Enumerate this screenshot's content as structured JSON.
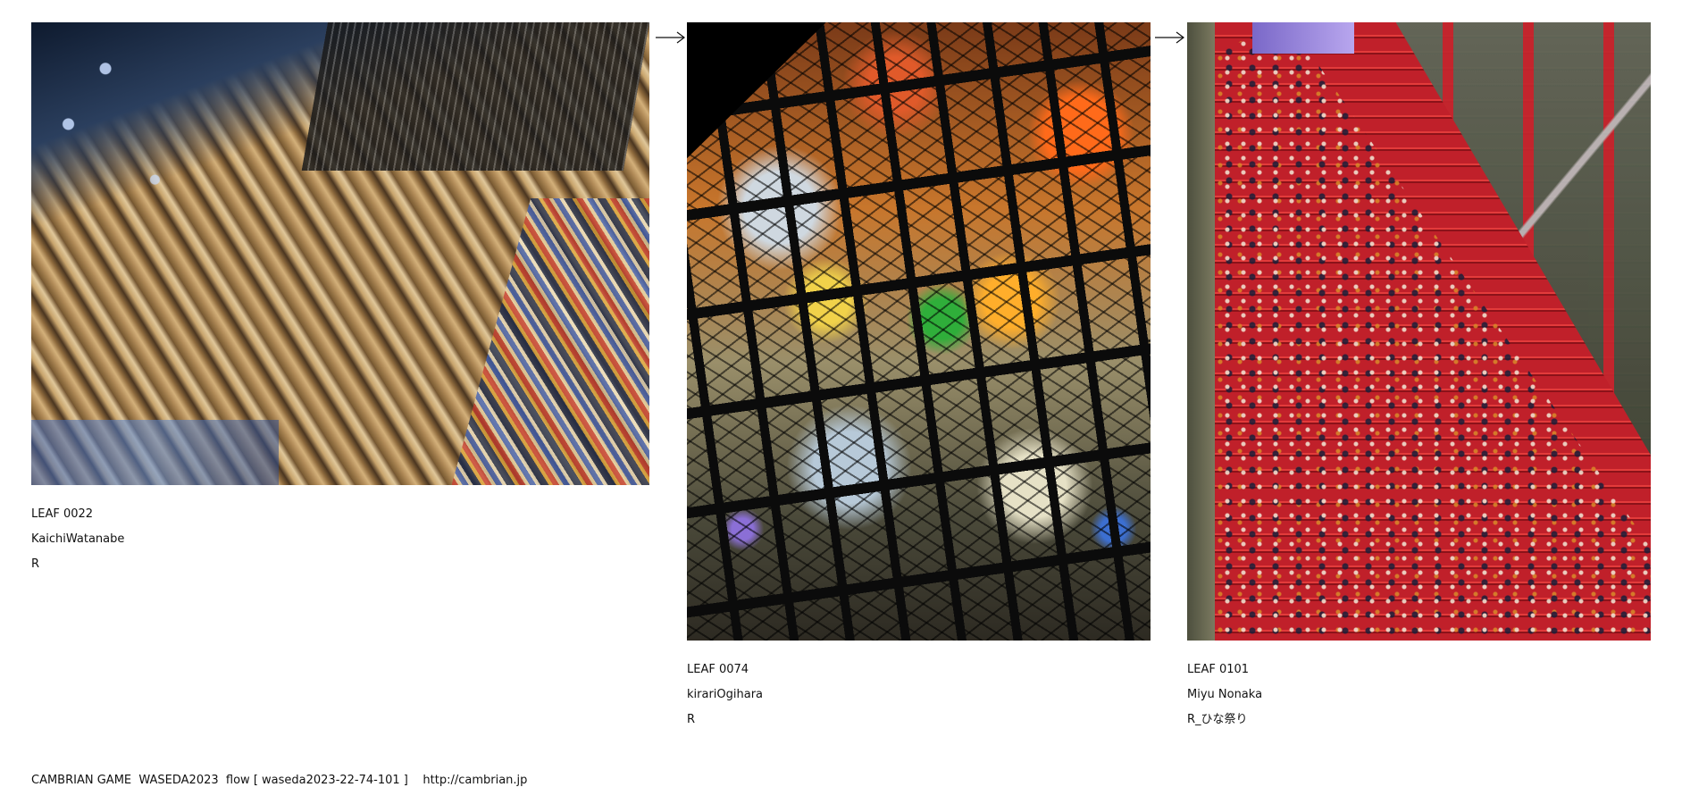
{
  "leaves": [
    {
      "leaf_id": "LEAF 0022",
      "author": "KaichiWatanabe",
      "tag": "R",
      "image_subject": "library-bookshelves"
    },
    {
      "leaf_id": "LEAF 0074",
      "author": "kirariOgihara",
      "tag": "R",
      "image_subject": "stained-glass"
    },
    {
      "leaf_id": "LEAF 0101",
      "author": "Miyu Nonaka",
      "tag": "R_ひな祭り",
      "image_subject": "hina-doll-steps"
    }
  ],
  "arrows": [
    "arrow-right-icon",
    "arrow-right-icon"
  ],
  "footer": {
    "text": "CAMBRIAN GAME  WASEDA2023  flow [ waseda2023-22-74-101 ]    http://cambrian.jp"
  }
}
